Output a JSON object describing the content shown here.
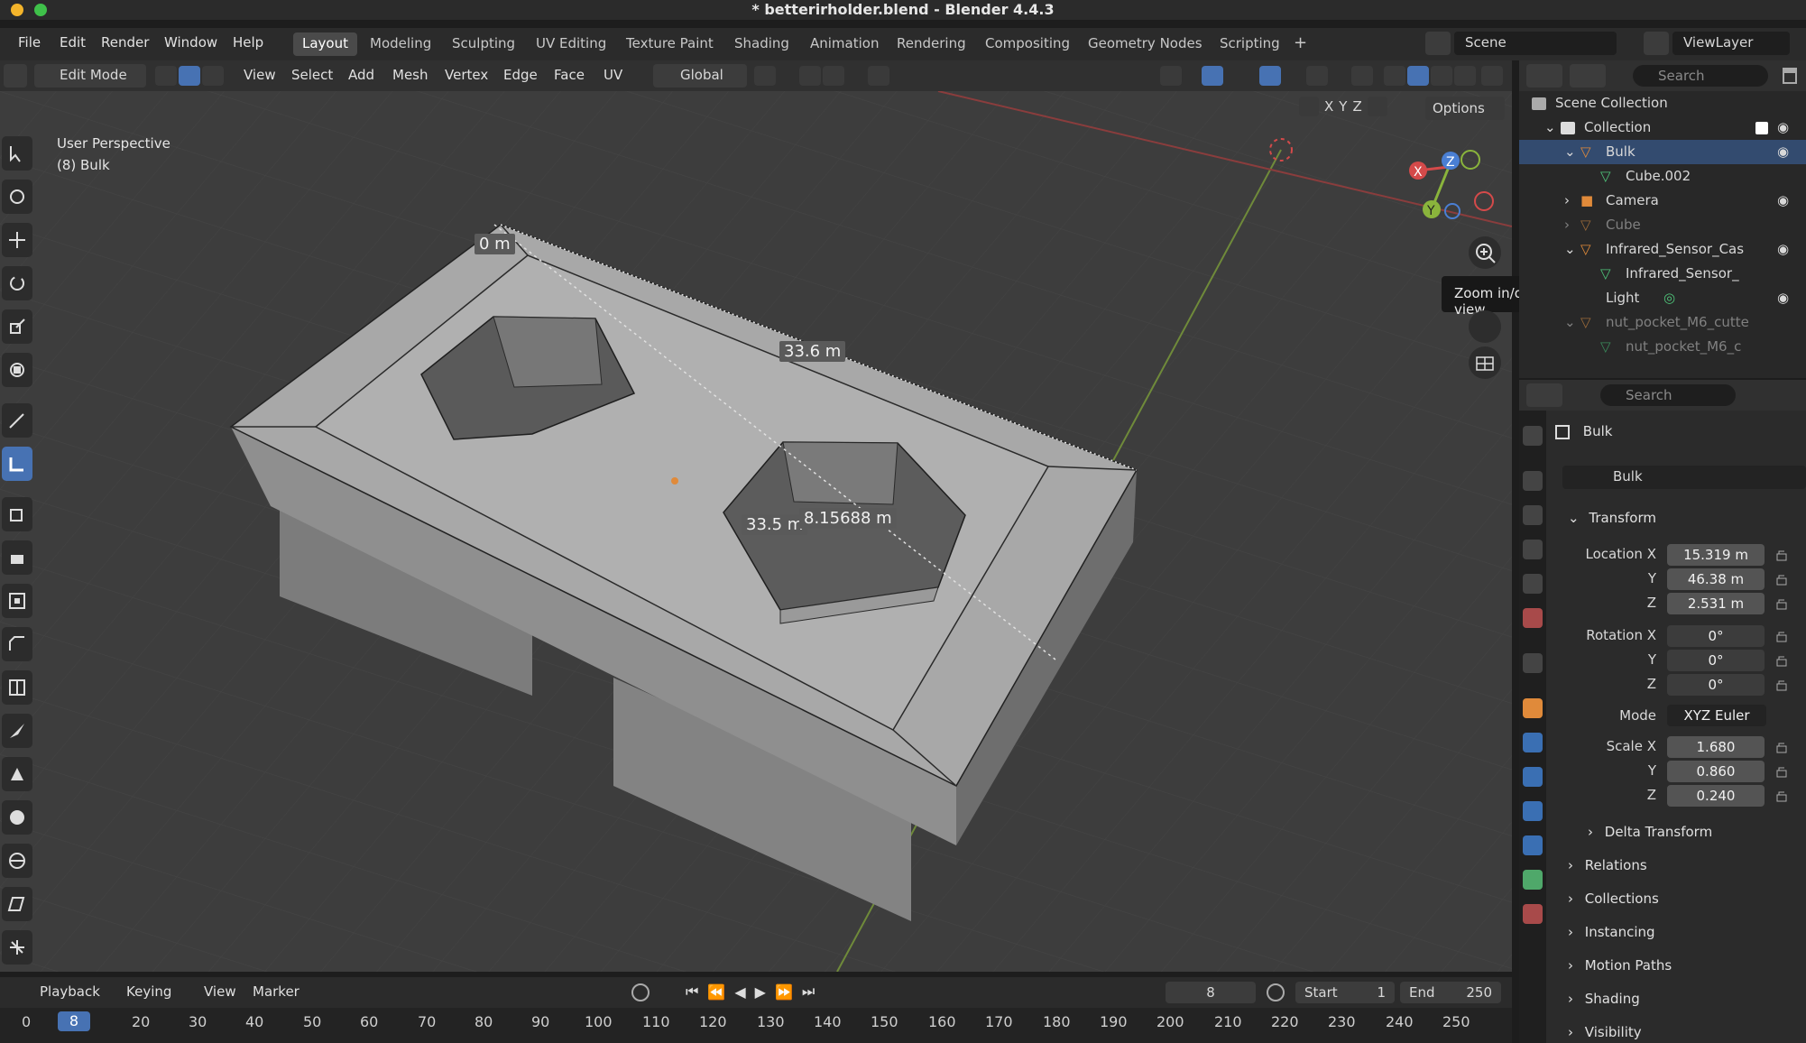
{
  "window": {
    "title": "* betterirholder.blend - Blender 4.4.3"
  },
  "menu": {
    "items": [
      "File",
      "Edit",
      "Render",
      "Window",
      "Help"
    ]
  },
  "workspaces": {
    "tabs": [
      "Layout",
      "Modeling",
      "Sculpting",
      "UV Editing",
      "Texture Paint",
      "Shading",
      "Animation",
      "Rendering",
      "Compositing",
      "Geometry Nodes",
      "Scripting"
    ],
    "active": "Layout",
    "add": "+"
  },
  "scene": {
    "scene_label": "Scene",
    "viewlayer_label": "ViewLayer"
  },
  "viewport_header": {
    "mode": "Edit Mode",
    "menus": [
      "View",
      "Select",
      "Add",
      "Mesh",
      "Vertex",
      "Edge",
      "Face",
      "UV"
    ],
    "transform_orientation": "Global",
    "axis_x": "X",
    "axis_y": "Y",
    "axis_z": "Z",
    "options": "Options"
  },
  "viewport": {
    "perspective": "User Perspective",
    "object_info": "(8) Bulk",
    "measure_a": "0 m",
    "measure_b": "33.6 m",
    "measure_c": "33.5 m",
    "measure_d": "8.15688 m",
    "tooltip": "Zoom in/out in the view",
    "gizmo_x": "X",
    "gizmo_y": "Y",
    "gizmo_z": "Z"
  },
  "timeline": {
    "menus": [
      "Playback",
      "Keying",
      "View",
      "Marker"
    ],
    "current_frame": "8",
    "start_label": "Start",
    "start": "1",
    "end_label": "End",
    "end": "250",
    "ticks": [
      "0",
      "20",
      "30",
      "40",
      "50",
      "60",
      "70",
      "80",
      "90",
      "100",
      "110",
      "120",
      "130",
      "140",
      "150",
      "160",
      "170",
      "180",
      "190",
      "200",
      "210",
      "220",
      "230",
      "240",
      "250"
    ]
  },
  "outliner": {
    "search_placeholder": "Search",
    "root": "Scene Collection",
    "rows": [
      {
        "label": "Collection",
        "indent": 1
      },
      {
        "label": "Bulk",
        "indent": 2
      },
      {
        "label": "Cube.002",
        "indent": 3
      },
      {
        "label": "Camera",
        "indent": 2
      },
      {
        "label": "Cube",
        "indent": 2
      },
      {
        "label": "Infrared_Sensor_Cas",
        "indent": 2
      },
      {
        "label": "Infrared_Sensor_",
        "indent": 3
      },
      {
        "label": "Light",
        "indent": 2
      },
      {
        "label": "nut_pocket_M6_cutte",
        "indent": 2
      },
      {
        "label": "nut_pocket_M6_c",
        "indent": 3
      }
    ]
  },
  "properties": {
    "search_placeholder": "Search",
    "object_name": "Bulk",
    "datablock_name": "Bulk",
    "transform_title": "Transform",
    "location_label": "Location X",
    "location": [
      "15.319 m",
      "46.38 m",
      "2.531 m"
    ],
    "rotation_label": "Rotation X",
    "rotation": [
      "0°",
      "0°",
      "0°"
    ],
    "mode_label": "Mode",
    "mode_value": "XYZ Euler",
    "scale_label": "Scale X",
    "scale": [
      "1.680",
      "0.860",
      "0.240"
    ],
    "axis_y": "Y",
    "axis_z": "Z",
    "panels": [
      "Delta Transform",
      "Relations",
      "Collections",
      "Instancing",
      "Motion Paths",
      "Shading",
      "Visibility"
    ]
  },
  "colors": {
    "accent": "#4772b3",
    "axis_x": "#d44a4a",
    "axis_y": "#8ab43c",
    "axis_z": "#4a7fd4",
    "object_orange": "#e08a3a"
  }
}
